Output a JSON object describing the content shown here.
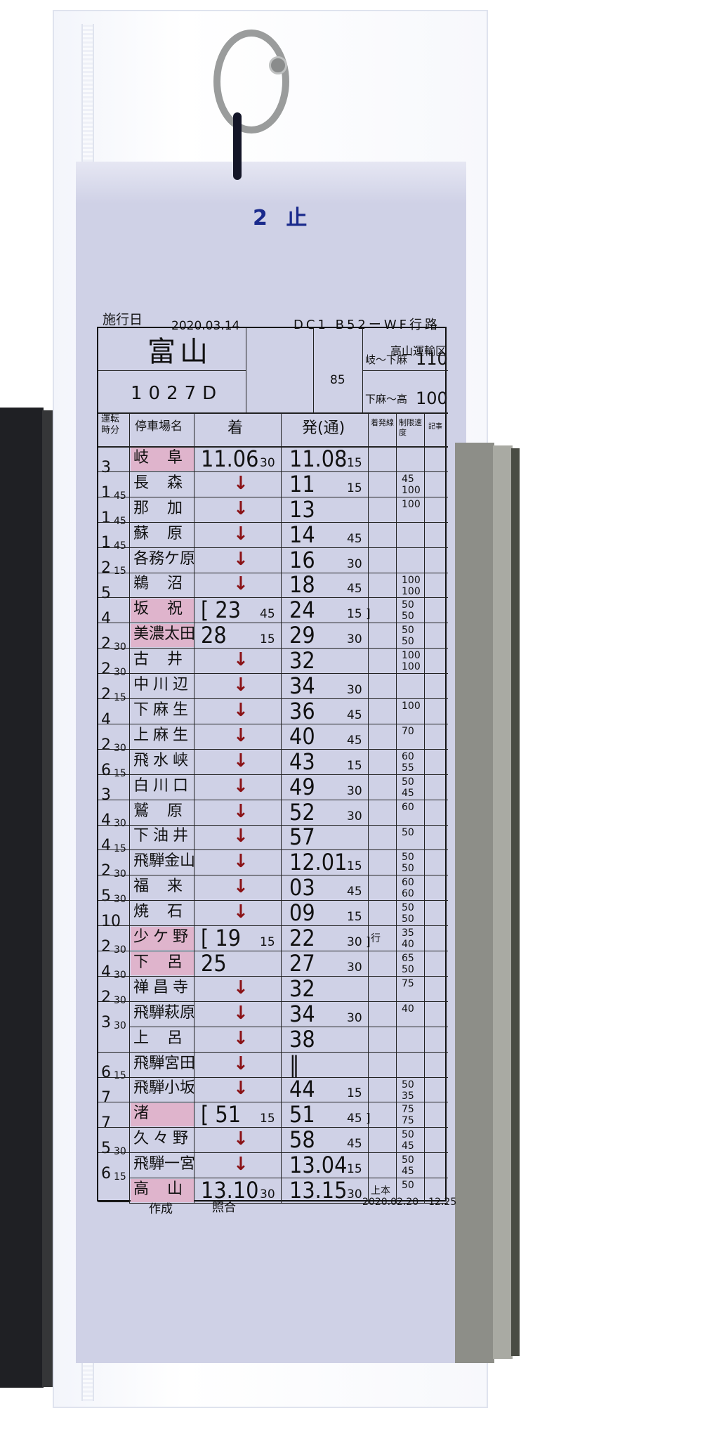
{
  "header": {
    "title_mark": "2 止",
    "effective_label": "施行日",
    "effective_date": "2020.03.14",
    "route_code": "DC1 B52ーWF行路",
    "depot": "高山運輸区",
    "destination": "富山",
    "train_number": "1027D",
    "center_value": "85",
    "speed_limits": [
      {
        "section": "岐～下麻",
        "value": "110"
      },
      {
        "section": "下麻～高",
        "value": "100"
      }
    ]
  },
  "columns": {
    "run_time": "運転時分",
    "station": "停車場名",
    "arrive": "着",
    "depart": "発(通)",
    "track": "着発線",
    "limit": "制限速度",
    "notes": "記事"
  },
  "rows": [
    {
      "run": "3",
      "run_sub": "",
      "station": "岐阜",
      "stop": true,
      "arr": "11.06",
      "arr_s": "30",
      "dep": "11.08",
      "dep_s": "15",
      "limit": "",
      "track": ""
    },
    {
      "run": "1",
      "run_sub": "45",
      "station": "長森",
      "stop": false,
      "arr": "",
      "arr_s": "",
      "dep": "11",
      "dep_s": "15",
      "limit": "45 / 100",
      "track": ""
    },
    {
      "run": "1",
      "run_sub": "45",
      "station": "那加",
      "stop": false,
      "arr": "",
      "arr_s": "",
      "dep": "13",
      "dep_s": "",
      "limit": "100",
      "track": ""
    },
    {
      "run": "1",
      "run_sub": "45",
      "station": "蘇原",
      "stop": false,
      "arr": "",
      "arr_s": "",
      "dep": "14",
      "dep_s": "45",
      "limit": "",
      "track": ""
    },
    {
      "run": "2",
      "run_sub": "15",
      "station": "各務ケ原",
      "stop": false,
      "arr": "",
      "arr_s": "",
      "dep": "16",
      "dep_s": "30",
      "limit": "",
      "track": ""
    },
    {
      "run": "5",
      "run_sub": "",
      "station": "鵜沼",
      "stop": false,
      "arr": "",
      "arr_s": "",
      "dep": "18",
      "dep_s": "45",
      "limit": "100 / 100",
      "track": ""
    },
    {
      "run": "4",
      "run_sub": "",
      "station": "坂祝",
      "stop": true,
      "arr": "[ 23",
      "arr_s": "45",
      "dep": "24",
      "dep_s": "15 ]",
      "limit": "50 / 50",
      "track": ""
    },
    {
      "run": "2",
      "run_sub": "30",
      "station": "美濃太田",
      "stop": true,
      "arr": "28",
      "arr_s": "15",
      "dep": "29",
      "dep_s": "30",
      "limit": "50 / 50",
      "track": ""
    },
    {
      "run": "2",
      "run_sub": "30",
      "station": "古井",
      "stop": false,
      "arr": "",
      "arr_s": "",
      "dep": "32",
      "dep_s": "",
      "limit": "100 / 100",
      "track": ""
    },
    {
      "run": "2",
      "run_sub": "15",
      "station": "中川辺",
      "stop": false,
      "arr": "",
      "arr_s": "",
      "dep": "34",
      "dep_s": "30",
      "limit": "",
      "track": ""
    },
    {
      "run": "4",
      "run_sub": "",
      "station": "下麻生",
      "stop": false,
      "arr": "",
      "arr_s": "",
      "dep": "36",
      "dep_s": "45",
      "limit": "100",
      "track": ""
    },
    {
      "run": "2",
      "run_sub": "30",
      "station": "上麻生",
      "stop": false,
      "arr": "",
      "arr_s": "",
      "dep": "40",
      "dep_s": "45",
      "limit": "70",
      "track": ""
    },
    {
      "run": "6",
      "run_sub": "15",
      "station": "飛水峡",
      "stop": false,
      "arr": "",
      "arr_s": "",
      "dep": "43",
      "dep_s": "15",
      "limit": "60 / 55",
      "track": ""
    },
    {
      "run": "3",
      "run_sub": "",
      "station": "白川口",
      "stop": false,
      "arr": "",
      "arr_s": "",
      "dep": "49",
      "dep_s": "30",
      "limit": "50 / 45",
      "track": ""
    },
    {
      "run": "4",
      "run_sub": "30",
      "station": "鷲原",
      "stop": false,
      "arr": "",
      "arr_s": "",
      "dep": "52",
      "dep_s": "30",
      "limit": "60",
      "track": ""
    },
    {
      "run": "4",
      "run_sub": "15",
      "station": "下油井",
      "stop": false,
      "arr": "",
      "arr_s": "",
      "dep": "57",
      "dep_s": "",
      "limit": "50",
      "track": ""
    },
    {
      "run": "2",
      "run_sub": "30",
      "station": "飛騨金山",
      "stop": false,
      "arr": "",
      "arr_s": "",
      "dep": "12.01",
      "dep_s": "15",
      "limit": "50 / 50",
      "track": ""
    },
    {
      "run": "5",
      "run_sub": "30",
      "station": "福来",
      "stop": false,
      "arr": "",
      "arr_s": "",
      "dep": "03",
      "dep_s": "45",
      "limit": "60 / 60",
      "track": ""
    },
    {
      "run": "10",
      "run_sub": "",
      "station": "焼石",
      "stop": false,
      "arr": "",
      "arr_s": "",
      "dep": "09",
      "dep_s": "15",
      "limit": "50 / 50",
      "track": ""
    },
    {
      "run": "2",
      "run_sub": "30",
      "station": "少ケ野",
      "stop": true,
      "arr": "[ 19",
      "arr_s": "15",
      "dep": "22",
      "dep_s": "30 ]",
      "limit": "35 / 40",
      "track": "行"
    },
    {
      "run": "4",
      "run_sub": "30",
      "station": "下呂",
      "stop": true,
      "arr": "25",
      "arr_s": "",
      "dep": "27",
      "dep_s": "30",
      "limit": "65 / 50",
      "track": ""
    },
    {
      "run": "2",
      "run_sub": "30",
      "station": "禅昌寺",
      "stop": false,
      "arr": "",
      "arr_s": "",
      "dep": "32",
      "dep_s": "",
      "limit": "75",
      "track": ""
    },
    {
      "run": "3",
      "run_sub": "30",
      "station": "飛騨萩原",
      "stop": false,
      "arr": "",
      "arr_s": "",
      "dep": "34",
      "dep_s": "30",
      "limit": "40",
      "track": ""
    },
    {
      "run": "",
      "run_sub": "",
      "station": "上呂",
      "stop": false,
      "arr": "",
      "arr_s": "",
      "dep": "38",
      "dep_s": "",
      "limit": "",
      "track": ""
    },
    {
      "run": "6",
      "run_sub": "15",
      "station": "飛騨宮田",
      "stop": false,
      "arr": "",
      "arr_s": "",
      "dep": "‖",
      "dep_s": "",
      "limit": "",
      "track": ""
    },
    {
      "run": "7",
      "run_sub": "",
      "station": "飛騨小坂",
      "stop": false,
      "arr": "",
      "arr_s": "",
      "dep": "44",
      "dep_s": "15",
      "limit": "50 / 35",
      "track": ""
    },
    {
      "run": "7",
      "run_sub": "",
      "station": "渚",
      "stop": true,
      "arr": "[ 51",
      "arr_s": "15",
      "dep": "51",
      "dep_s": "45 ]",
      "limit": "75 / 75",
      "track": ""
    },
    {
      "run": "5",
      "run_sub": "30",
      "station": "久々野",
      "stop": false,
      "arr": "",
      "arr_s": "",
      "dep": "58",
      "dep_s": "45",
      "limit": "50 / 45",
      "track": ""
    },
    {
      "run": "6",
      "run_sub": "15",
      "station": "飛騨一宮",
      "stop": false,
      "arr": "",
      "arr_s": "",
      "dep": "13.04",
      "dep_s": "15",
      "limit": "50 / 45",
      "track": ""
    },
    {
      "run": "",
      "run_sub": "",
      "station": "高山",
      "stop": true,
      "arr": "13.10",
      "arr_s": "30",
      "dep": "13.15",
      "dep_s": "30",
      "limit": "50",
      "track": "上本"
    }
  ],
  "footer": {
    "made": "作成",
    "checked": "照合",
    "stamp": "2020.02.20　12.25"
  },
  "colors": {
    "card": "#cfd1e6",
    "stop_highlight": "#dfb4cc",
    "arrow": "#8a1216",
    "title": "#1a2a8c"
  }
}
